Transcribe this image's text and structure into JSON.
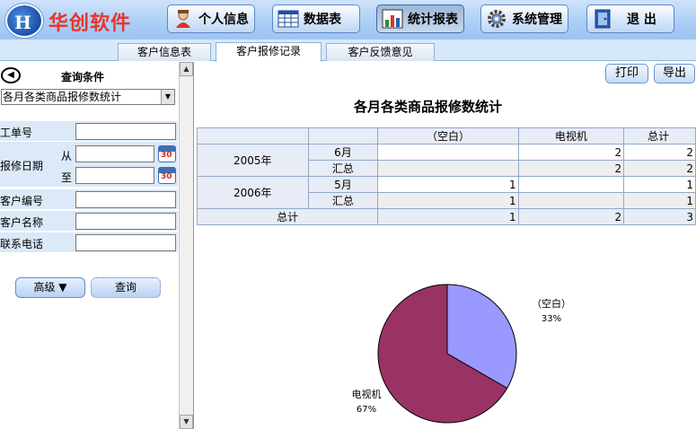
{
  "brand": "华创软件",
  "nav": [
    {
      "label": "个人信息",
      "icon": "person-icon"
    },
    {
      "label": "数据表",
      "icon": "table-icon"
    },
    {
      "label": "统计报表",
      "icon": "chart-icon",
      "active": true
    },
    {
      "label": "系统管理",
      "icon": "gear-icon"
    },
    {
      "label": "退 出",
      "icon": "exit-icon"
    }
  ],
  "tabs": [
    "客户信息表",
    "客户报修记录",
    "客户反馈意见"
  ],
  "query": {
    "title": "查询条件",
    "report": "各月各类商品报修数统计",
    "labels": {
      "order_no": "工单号",
      "repair_date": "报修日期",
      "from": "从",
      "to": "至",
      "customer_no": "客户编号",
      "customer_name": "客户名称",
      "phone": "联系电话"
    },
    "calendar_num": "30",
    "advanced": "高级 ▼",
    "search": "查询"
  },
  "toolbar": {
    "print": "打印",
    "export": "导出"
  },
  "report": {
    "title": "各月各类商品报修数统计",
    "headers": [
      "（空白）",
      "电视机",
      "总计"
    ],
    "rows": {
      "y2005": "2005年",
      "y2006": "2006年",
      "m6": "6月",
      "m5": "5月",
      "sub": "汇总",
      "total": "总计"
    },
    "cells": {
      "r1": [
        "",
        "2",
        "2"
      ],
      "r2": [
        "",
        "2",
        "2"
      ],
      "r3": [
        "1",
        "",
        "1"
      ],
      "r4": [
        "1",
        "",
        "1"
      ],
      "r5": [
        "1",
        "2",
        "3"
      ]
    }
  },
  "chart_data": {
    "type": "pie",
    "slices": [
      {
        "label": "（空白）",
        "value": 1,
        "percent": "33%",
        "color": "#9999ff"
      },
      {
        "label": "电视机",
        "value": 2,
        "percent": "67%",
        "color": "#993366"
      }
    ]
  }
}
